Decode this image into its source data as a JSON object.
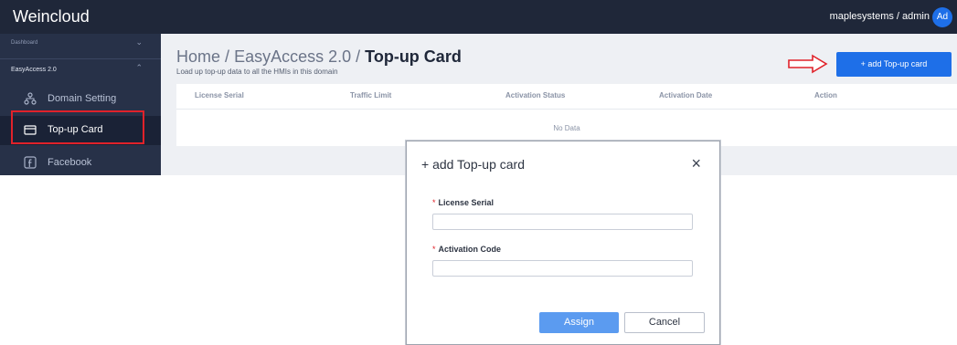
{
  "header": {
    "brand": "Weincloud",
    "user": "maplesystems / admin",
    "avatar_initials": "Ad"
  },
  "sidebar": {
    "sections": [
      {
        "label": "Dashboard",
        "chevron": "⌄"
      },
      {
        "label": "EasyAccess 2.0",
        "chevron": "⌃"
      }
    ],
    "items": [
      {
        "label": "Domain Setting",
        "icon": "network-icon"
      },
      {
        "label": "Top-up Card",
        "icon": "card-icon",
        "active": true
      },
      {
        "label": "Facebook",
        "icon": "facebook-icon"
      }
    ]
  },
  "page": {
    "breadcrumb": [
      "Home",
      "EasyAccess 2.0",
      "Top-up Card"
    ],
    "breadcrumb_sep": "/",
    "subtitle": "Load up top-up data to all the HMIs in this domain",
    "add_button": "+ add Top-up card"
  },
  "table": {
    "columns": [
      "License Serial",
      "Traffic Limit",
      "Activation Status",
      "Activation Date",
      "Action"
    ],
    "empty_text": "No Data"
  },
  "modal": {
    "title": "+ add Top-up card",
    "close": "×",
    "fields": [
      {
        "label": "License Serial",
        "required": "*",
        "value": ""
      },
      {
        "label": "Activation Code",
        "required": "*",
        "value": ""
      }
    ],
    "assign_button": "Assign",
    "cancel_button": "Cancel"
  },
  "colors": {
    "topbar": "#1f2739",
    "sidebar": "#273148",
    "accent": "#1e6fe8",
    "highlight_red": "#e0222a"
  }
}
